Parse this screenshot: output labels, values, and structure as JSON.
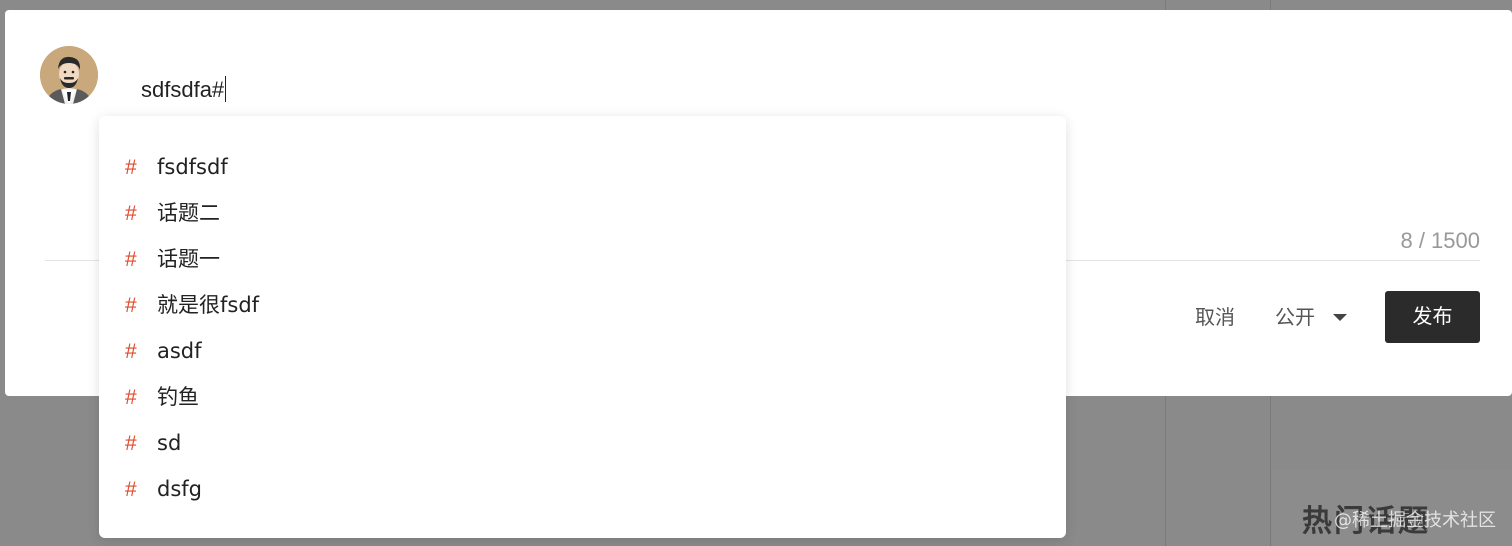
{
  "editor": {
    "text": "sdfsdfa#",
    "counter": "8 / 1500"
  },
  "actions": {
    "cancel_label": "取消",
    "visibility_label": "公开",
    "publish_label": "发布"
  },
  "topic_suggestions": [
    {
      "hash": "#",
      "label": "fsdfsdf"
    },
    {
      "hash": "#",
      "label": "话题二"
    },
    {
      "hash": "#",
      "label": "话题一"
    },
    {
      "hash": "#",
      "label": "就是很fsdf"
    },
    {
      "hash": "#",
      "label": "asdf"
    },
    {
      "hash": "#",
      "label": "钓鱼"
    },
    {
      "hash": "#",
      "label": "sd"
    },
    {
      "hash": "#",
      "label": "dsfg"
    }
  ],
  "background": {
    "hot_topics_title": "热门话题",
    "watermark": "@稀土掘金技术社区"
  },
  "colors": {
    "accent_hash": "#e14a2b",
    "publish_bg": "#2b2b2b",
    "overlay": "#8a8a8a"
  },
  "icons": {
    "avatar": "user-avatar-illustration",
    "dropdown": "caret-down-icon"
  }
}
